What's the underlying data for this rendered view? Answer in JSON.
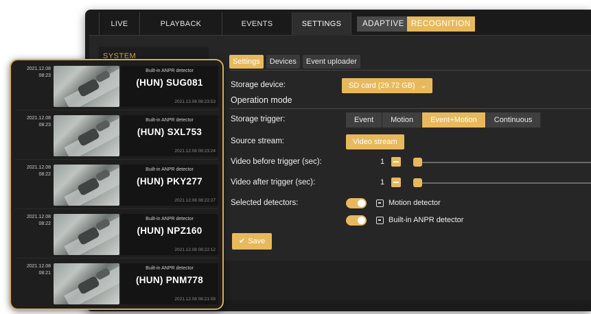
{
  "nav": {
    "tabs": [
      "LIVE",
      "PLAYBACK",
      "EVENTS",
      "SETTINGS"
    ],
    "active_tab": "SETTINGS",
    "brand_left": "ADAPTIVE",
    "brand_right": "RECOGNITION"
  },
  "sidebar": {
    "title": "SYSTEM"
  },
  "subtabs": [
    "Settings",
    "Devices",
    "Event uploader"
  ],
  "form": {
    "storage_device_label": "Storage device:",
    "storage_device_value": "SD card (29.72 GB)",
    "operation_mode_title": "Operation mode",
    "storage_trigger_label": "Storage trigger:",
    "trigger_options": [
      "Event",
      "Motion",
      "Event+Motion",
      "Continuous"
    ],
    "trigger_selected": "Event+Motion",
    "source_stream_label": "Source stream:",
    "source_stream_value": "Video stream",
    "video_before_label": "Video before trigger (sec):",
    "video_before_value": "1",
    "video_after_label": "Video after trigger (sec):",
    "video_after_value": "1",
    "selected_detectors_label": "Selected detectors:",
    "detectors": [
      {
        "label": "Motion detector",
        "enabled": true
      },
      {
        "label": "Built-in ANPR detector",
        "enabled": true
      }
    ],
    "save_label": "Save"
  },
  "detections": [
    {
      "date": "2021.12.08",
      "time": "08:23",
      "source": "Built-in ANPR detector",
      "plate": "(HUN) SUG081",
      "timestamp": "2021.12.08 08:23:53"
    },
    {
      "date": "2021.12.08",
      "time": "08:23",
      "source": "Built-in ANPR detector",
      "plate": "(HUN) SXL753",
      "timestamp": "2021.12.08 08:23:24"
    },
    {
      "date": "2021.12.08",
      "time": "08:22",
      "source": "Built-in ANPR detector",
      "plate": "(HUN) PKY277",
      "timestamp": "2021.12.08 08:22:27"
    },
    {
      "date": "2021.12.08",
      "time": "08:22",
      "source": "Built-in ANPR detector",
      "plate": "(HUN) NPZ160",
      "timestamp": "2021.12.08 08:22:12"
    },
    {
      "date": "2021.12.08",
      "time": "08:21",
      "source": "Built-in ANPR detector",
      "plate": "(HUN) PNM778",
      "timestamp": "2021.12.08 08:21:08"
    }
  ],
  "colors": {
    "accent": "#e8b95c",
    "background": "#262626",
    "panel": "#1e1e1e"
  }
}
